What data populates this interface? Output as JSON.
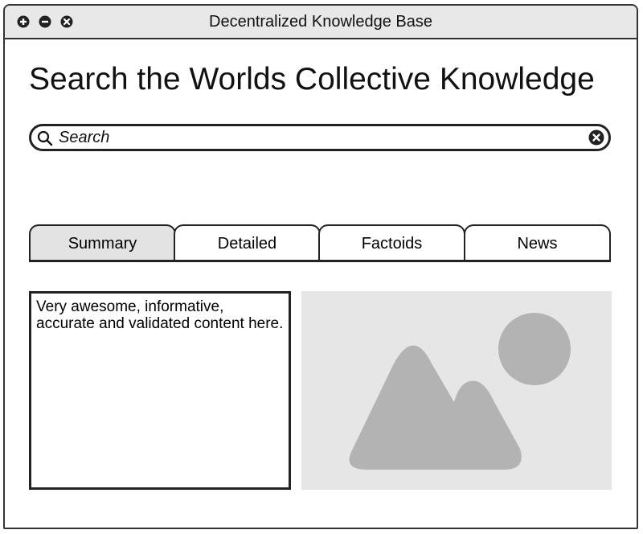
{
  "window": {
    "title": "Decentralized Knowledge Base",
    "controls": [
      "plus-icon",
      "minus-icon",
      "close-icon"
    ]
  },
  "main": {
    "heading": "Search the Worlds Collective Knowledge",
    "search": {
      "placeholder": "Search",
      "value": "",
      "leading_icon": "search-icon",
      "trailing_icon": "clear-icon"
    },
    "tabs": [
      {
        "label": "Summary",
        "active": true
      },
      {
        "label": "Detailed",
        "active": false
      },
      {
        "label": "Factoids",
        "active": false
      },
      {
        "label": "News",
        "active": false
      }
    ],
    "content_text": "Very awesome, informative, accurate and validated content here.",
    "image_icon": "image-placeholder-icon"
  },
  "colors": {
    "titlebar": "#e8e8e8",
    "active_tab": "#e3e3e3",
    "image_bg": "#e6e6e6",
    "image_shapes": "#b3b3b3",
    "stroke": "#222222"
  }
}
